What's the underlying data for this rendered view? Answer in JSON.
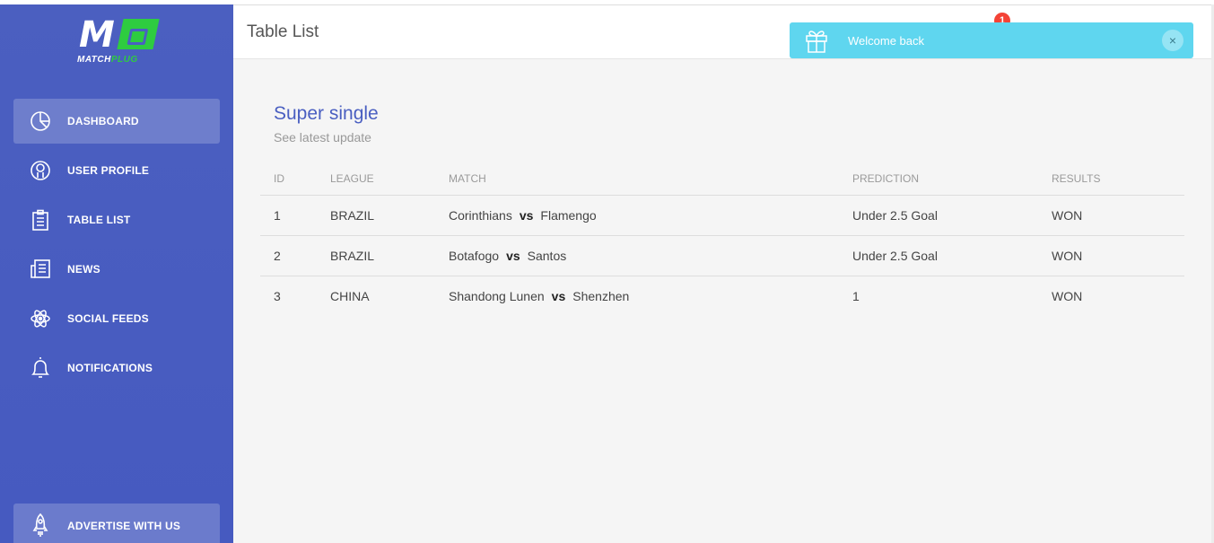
{
  "brand": {
    "logo_mark": "M",
    "logo_word_a": "MATCH",
    "logo_word_b": "PLUG",
    "accent": "#2ecc40",
    "sidebar_color": "#4a5fc1"
  },
  "sidebar": {
    "items": [
      {
        "label": "DASHBOARD",
        "icon": "pie-chart-icon",
        "active": true
      },
      {
        "label": "USER PROFILE",
        "icon": "user-icon",
        "active": false
      },
      {
        "label": "TABLE LIST",
        "icon": "clipboard-icon",
        "active": false
      },
      {
        "label": "NEWS",
        "icon": "newspaper-icon",
        "active": false
      },
      {
        "label": "SOCIAL FEEDS",
        "icon": "atom-icon",
        "active": false
      },
      {
        "label": "NOTIFICATIONS",
        "icon": "bell-icon",
        "active": false
      }
    ],
    "bottom": {
      "label": "ADVERTISE WITH US",
      "icon": "rocket-icon"
    }
  },
  "header": {
    "title": "Table List",
    "notification_count": "1"
  },
  "toast": {
    "message": "Welcome back",
    "icon": "gift-icon",
    "close": "×",
    "color": "#5fd6ef"
  },
  "card": {
    "title": "Super single",
    "subtitle": "See latest update",
    "columns": [
      "ID",
      "LEAGUE",
      "MATCH",
      "PREDICTION",
      "RESULTS"
    ],
    "vs_label": "vs",
    "rows": [
      {
        "id": "1",
        "league": "BRAZIL",
        "home": "Corinthians",
        "away": "Flamengo",
        "prediction": "Under 2.5 Goal",
        "result": "WON"
      },
      {
        "id": "2",
        "league": "BRAZIL",
        "home": "Botafogo",
        "away": "Santos",
        "prediction": "Under 2.5 Goal",
        "result": "WON"
      },
      {
        "id": "3",
        "league": "CHINA",
        "home": "Shandong Lunen",
        "away": "Shenzhen",
        "prediction": "1",
        "result": "WON"
      }
    ]
  }
}
